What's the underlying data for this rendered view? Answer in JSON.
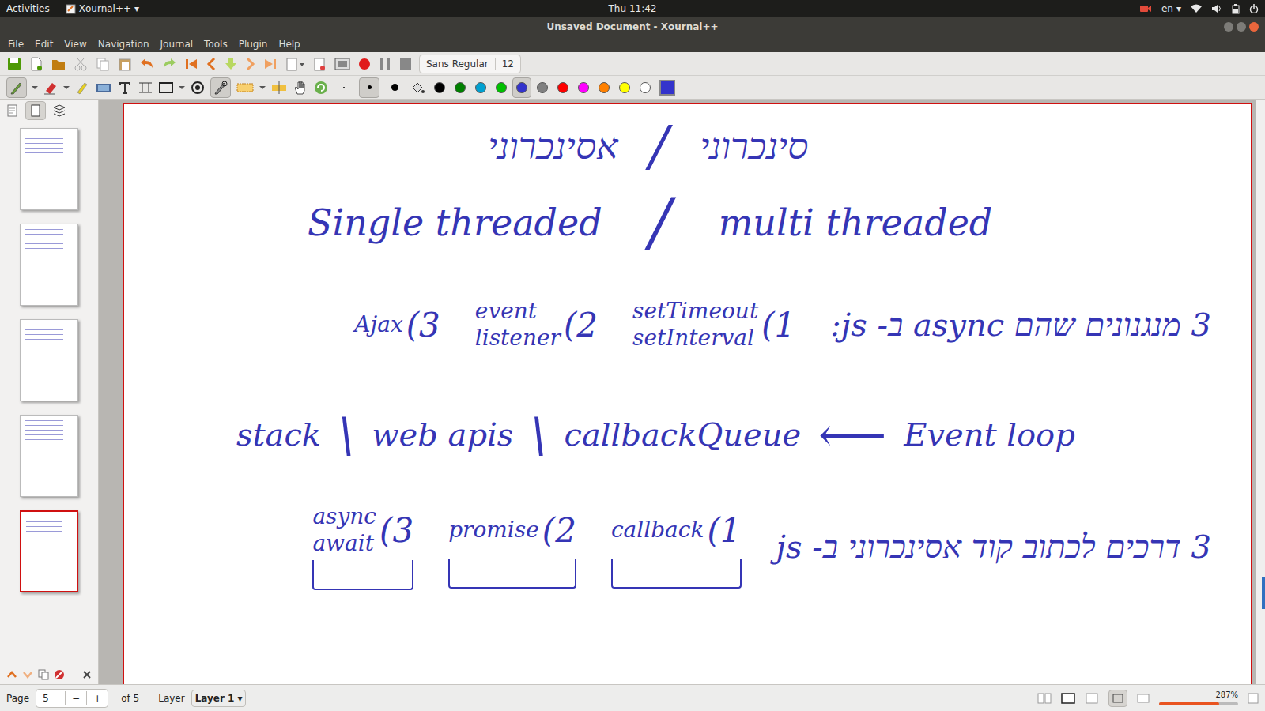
{
  "topbar": {
    "activities": "Activities",
    "app": "Xournal++",
    "app_arrow": "▾",
    "clock": "Thu 11:42",
    "lang": "en",
    "lang_arrow": "▾"
  },
  "window": {
    "title": "Unsaved Document - Xournal++"
  },
  "menu": [
    "File",
    "Edit",
    "View",
    "Navigation",
    "Journal",
    "Tools",
    "Plugin",
    "Help"
  ],
  "font_button": {
    "font": "Sans Regular",
    "size": "12"
  },
  "toolbar": {
    "pen_selected": true,
    "shape_recognizer_selected": true,
    "fine_size_selected": true
  },
  "palette": [
    {
      "color": "#000000",
      "selected": false
    },
    {
      "color": "#008000",
      "selected": false
    },
    {
      "color": "#00a0d0",
      "selected": false
    },
    {
      "color": "#00c000",
      "selected": false
    },
    {
      "color": "#3333cc",
      "selected": true
    },
    {
      "color": "#808080",
      "selected": false
    },
    {
      "color": "#ff0000",
      "selected": false
    },
    {
      "color": "#ff00ff",
      "selected": false
    },
    {
      "color": "#ff8000",
      "selected": false
    },
    {
      "color": "#ffff00",
      "selected": false
    },
    {
      "color": "#ffffff",
      "selected": false
    }
  ],
  "current_color": "#3333cc",
  "sidebar": {
    "pages": [
      {
        "selected": false
      },
      {
        "selected": false
      },
      {
        "selected": false
      },
      {
        "selected": false
      },
      {
        "selected": true
      }
    ]
  },
  "page": {
    "title": [
      "סינכרוני",
      "/",
      "אסינכרוני"
    ],
    "threads": [
      "Single threaded",
      "/",
      "multi threaded"
    ],
    "mechanisms": {
      "heading": "3 מנגנונים שהם async ב- js:",
      "items": [
        {
          "num": "1)",
          "lines": [
            "setTimeout",
            "setInterval"
          ]
        },
        {
          "num": "2)",
          "lines": [
            "event",
            "listener"
          ]
        },
        {
          "num": "3)",
          "lines": [
            "Ajax"
          ]
        }
      ]
    },
    "loop": [
      "stack",
      "\\",
      "web apis",
      "\\",
      "callbackQueue",
      "⟵",
      "Event loop"
    ],
    "ways": {
      "heading": "3 דרכים לכתוב קוד אסינכרוני ב- js",
      "items": [
        {
          "num": "1)",
          "lines": [
            "callback"
          ]
        },
        {
          "num": "2)",
          "lines": [
            "promise"
          ]
        },
        {
          "num": "3)",
          "lines": [
            "async",
            "await"
          ]
        }
      ]
    }
  },
  "status": {
    "page_label": "Page",
    "page": "5",
    "minus": "−",
    "plus": "+",
    "of": "of 5",
    "layer_label": "Layer",
    "layer": "Layer 1",
    "layer_arrow": "▾",
    "zoom": "287%",
    "zoom_level": 0.76
  }
}
